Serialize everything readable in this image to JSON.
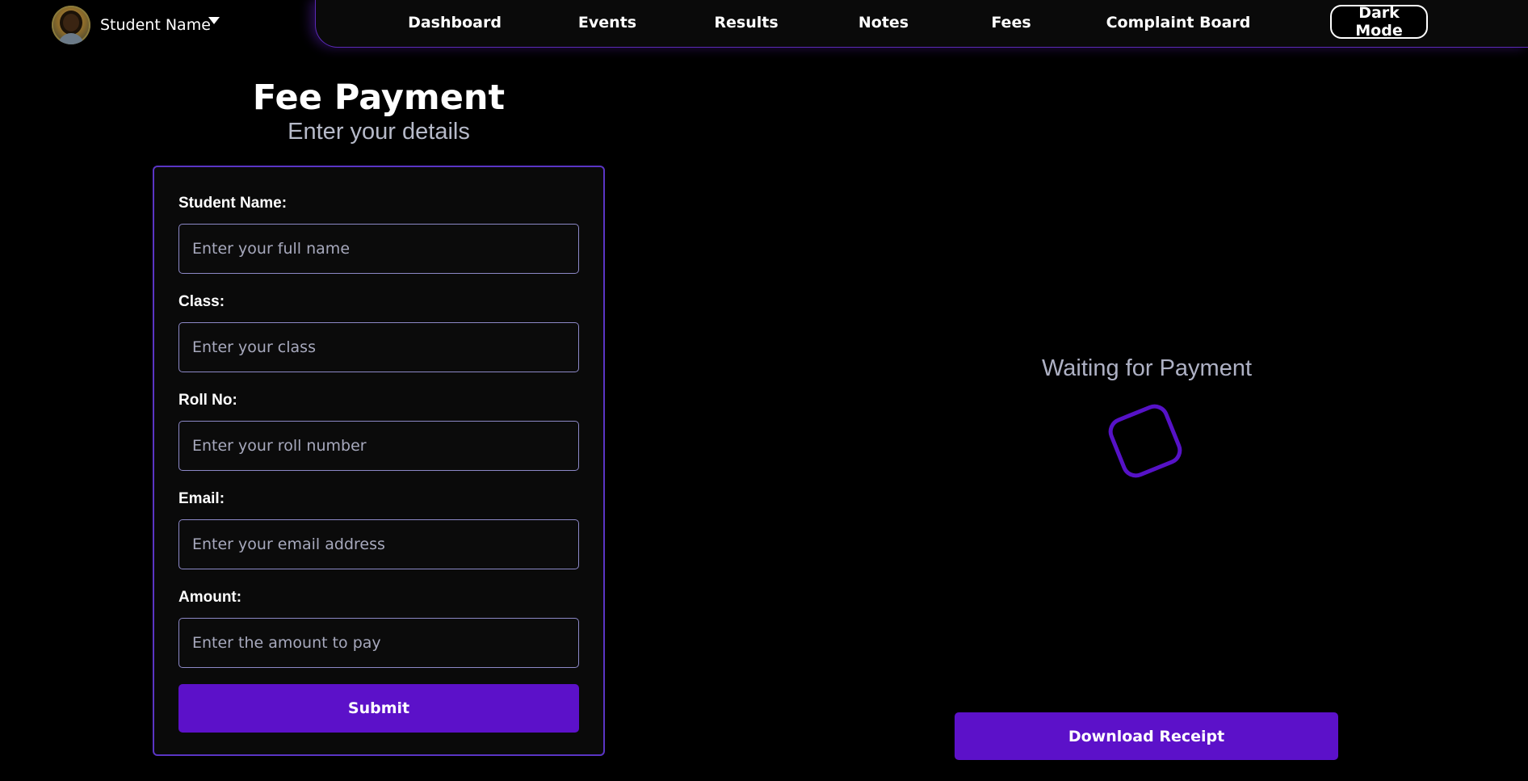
{
  "profile": {
    "name": "Student Name",
    "avatar_icon": "student-avatar",
    "dropdown_icon": "caret-down-icon"
  },
  "nav": {
    "links": [
      "Dashboard",
      "Events",
      "Results",
      "Notes",
      "Fees",
      "Complaint Board"
    ],
    "theme_toggle": "Dark Mode"
  },
  "form": {
    "title": "Fee Payment",
    "subtitle": "Enter your details",
    "fields": [
      {
        "label": "Student Name:",
        "placeholder": "Enter your full name",
        "value": ""
      },
      {
        "label": "Class:",
        "placeholder": "Enter your class",
        "value": ""
      },
      {
        "label": "Roll No:",
        "placeholder": "Enter your roll number",
        "value": ""
      },
      {
        "label": "Email:",
        "placeholder": "Enter your email address",
        "value": ""
      },
      {
        "label": "Amount:",
        "placeholder": "Enter the amount to pay",
        "value": ""
      }
    ],
    "submit_label": "Submit"
  },
  "status": {
    "text": "Waiting for Payment",
    "download_label": "Download Receipt"
  },
  "colors": {
    "background": "#000000",
    "accent": "#5c11c9",
    "card_border": "#5a35c4",
    "input_border": "#8c88c7",
    "muted_text": "#aeb1c4"
  }
}
